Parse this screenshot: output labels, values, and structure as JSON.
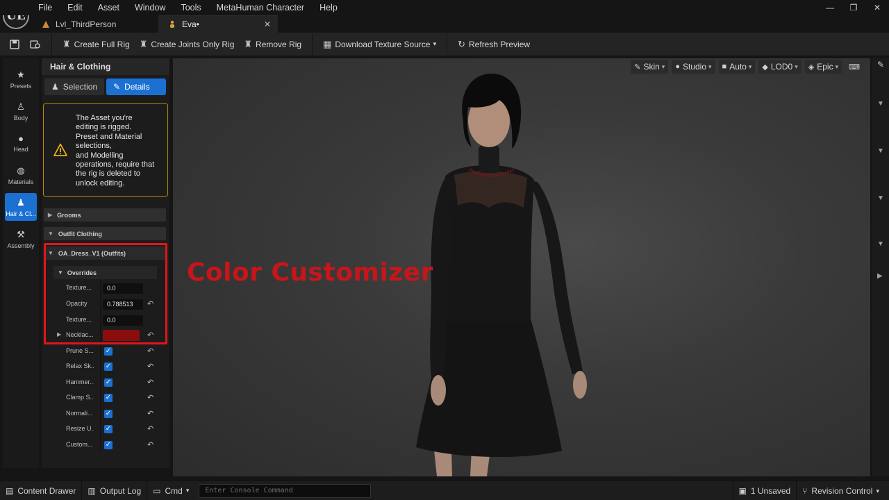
{
  "app": {
    "logo": "UE",
    "menu": [
      "File",
      "Edit",
      "Asset",
      "Window",
      "Tools",
      "MetaHuman Character",
      "Help"
    ],
    "window_controls": {
      "minimize": "—",
      "restore": "❐",
      "close": "✕"
    }
  },
  "tabs": [
    {
      "label": "Lvl_ThirdPerson",
      "icon": "level-icon",
      "active": false
    },
    {
      "label": "Eva•",
      "icon": "metahuman-icon",
      "active": true
    }
  ],
  "toolbar": {
    "create_full_rig": "Create Full Rig",
    "create_joints_only_rig": "Create Joints Only Rig",
    "remove_rig": "Remove Rig",
    "download_texture_source": "Download Texture Source",
    "refresh_preview": "Refresh Preview"
  },
  "leftnav": [
    {
      "label": "Presets",
      "icon": "star-icon",
      "glyph": "★",
      "active": false
    },
    {
      "label": "Body",
      "icon": "body-icon",
      "glyph": "♙",
      "active": false
    },
    {
      "label": "Head",
      "icon": "head-icon",
      "glyph": "●",
      "active": false
    },
    {
      "label": "Materials",
      "icon": "materials-icon",
      "glyph": "◍",
      "active": false
    },
    {
      "label": "Hair & Cl...",
      "icon": "hair-clothing-icon",
      "glyph": "♟",
      "active": true
    },
    {
      "label": "Assembly",
      "icon": "hammer-icon",
      "glyph": "⚒",
      "active": false
    }
  ],
  "panel": {
    "title": "Hair & Clothing",
    "selection_label": "Selection",
    "details_label": "Details",
    "warning": "The Asset you're\nediting is rigged.\nPreset and Material\nselections,\nand Modelling\noperations, require that\nthe rig is deleted to\nunlock editing.",
    "grooms": "Grooms",
    "outfit_clothing": "Outfit Clothing",
    "outfit_name": "OA_Dress_V1 (Outfits)",
    "overrides": "Overrides",
    "rows": [
      {
        "label": "Texture...",
        "type": "number",
        "value": "0.0",
        "reset": false
      },
      {
        "label": "Opacity",
        "type": "number",
        "value": "0.788513",
        "reset": true
      },
      {
        "label": "Texture...",
        "type": "number",
        "value": "0.0",
        "reset": false
      },
      {
        "label": "Necklac...",
        "type": "color",
        "value": "#8b0e0e",
        "reset": true,
        "expandable": true
      }
    ],
    "checks": [
      {
        "label": "Prune S...",
        "checked": true
      },
      {
        "label": "Relax Sk...",
        "checked": true
      },
      {
        "label": "Hammer...",
        "checked": true
      },
      {
        "label": "Clamp S...",
        "checked": true
      },
      {
        "label": "Normali...",
        "checked": true
      },
      {
        "label": "Resize U...",
        "checked": true
      },
      {
        "label": "Custom...",
        "checked": true
      }
    ]
  },
  "viewport": {
    "controls": [
      {
        "label": "Skin",
        "icon": "skin-icon",
        "glyph": "✎"
      },
      {
        "label": "Studio",
        "icon": "light-bulb-icon",
        "glyph": "●"
      },
      {
        "label": "Auto",
        "icon": "camera-icon",
        "glyph": "■"
      },
      {
        "label": "LOD0",
        "icon": "cube-icon",
        "glyph": "◆"
      },
      {
        "label": "Epic",
        "icon": "gem-icon",
        "glyph": "◈"
      }
    ],
    "overlay_title": "Color Customizer"
  },
  "statusbar": {
    "content_drawer": "Content Drawer",
    "output_log": "Output Log",
    "cmd": "Cmd",
    "console_placeholder": "Enter Console Command",
    "unsaved": "1 Unsaved",
    "revision_control": "Revision Control"
  },
  "colors": {
    "accent": "#1b70d2",
    "highlight_border": "#e0161a",
    "warning_border": "#b8860b",
    "necklace_color": "#8b0e0e"
  }
}
